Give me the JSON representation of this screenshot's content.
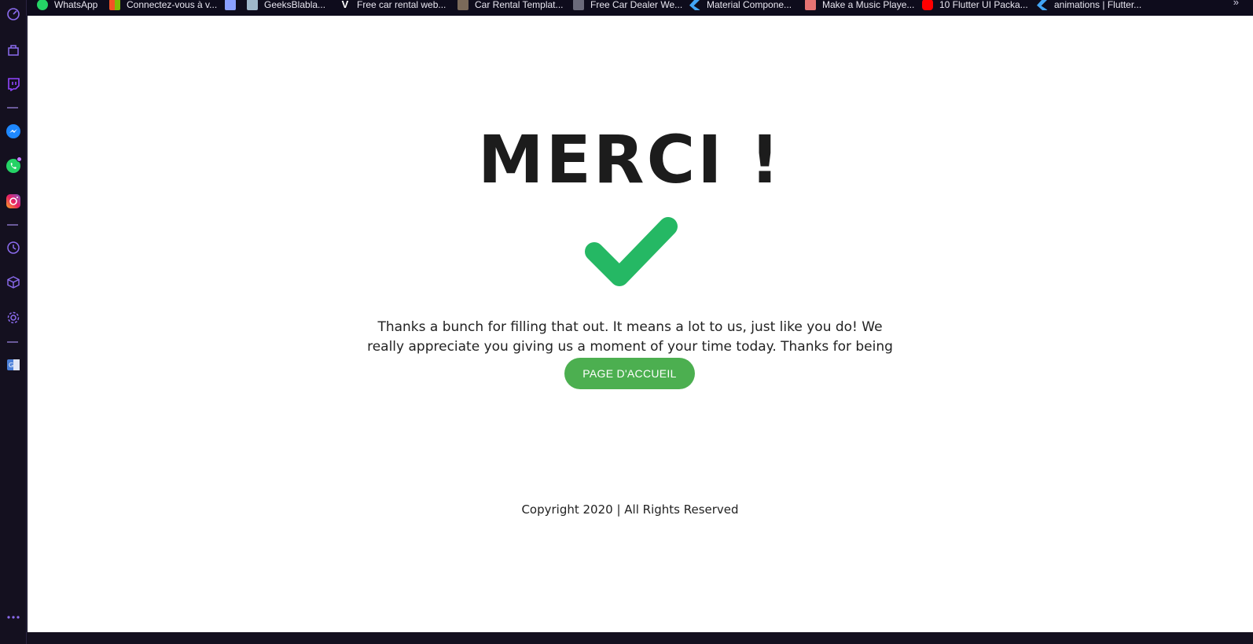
{
  "bookmarks": [
    {
      "label": "WhatsApp",
      "icon": "whatsapp-icon",
      "color": "#25d366"
    },
    {
      "label": "Connectez-vous à v...",
      "icon": "microsoft-icon",
      "color": "#f35325"
    },
    {
      "label": "",
      "icon": "bookmark-icon",
      "color": "#8aa0ff"
    },
    {
      "label": "GeeksBlabla...",
      "icon": "geeksblabla-icon",
      "color": "#9fb7c9"
    },
    {
      "label": "Free car rental web...",
      "icon": "v-icon",
      "color": "#ffffff"
    },
    {
      "label": "Car Rental Templat...",
      "icon": "cube-icon",
      "color": "#7b6a5a"
    },
    {
      "label": "Free Car Dealer We...",
      "icon": "cube-icon",
      "color": "#6a6a7a"
    },
    {
      "label": "Material Compone...",
      "icon": "flutter-icon",
      "color": "#42a5f5"
    },
    {
      "label": "Make a Music Playe...",
      "icon": "music-icon",
      "color": "#e57373"
    },
    {
      "label": "10 Flutter UI Packa...",
      "icon": "youtube-icon",
      "color": "#ff0000"
    },
    {
      "label": "animations | Flutter...",
      "icon": "flutter-icon",
      "color": "#42a5f5"
    }
  ],
  "bookmarks_more": "»",
  "page": {
    "title": "MERCI !",
    "message": "Thanks a bunch for filling that out. It means a lot to us, just like you do! We really appreciate you giving us a moment of your time today. Thanks for being you.",
    "button_label": "PAGE D'ACCUEIL",
    "footer": "Copyright 2020 | All Rights Reserved"
  },
  "colors": {
    "check_green": "#25b864",
    "button_green": "#4caf50",
    "sidebar_accent": "#8c6cf0"
  }
}
